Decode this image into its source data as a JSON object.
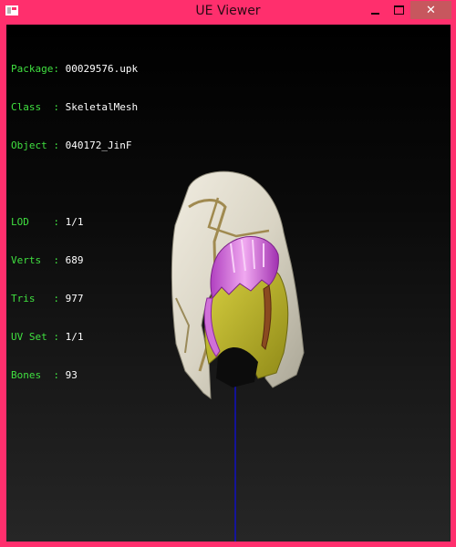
{
  "window": {
    "title": "UE Viewer",
    "close_glyph": "✕"
  },
  "info": {
    "group1": [
      {
        "label": "Package",
        "value": "00029576.upk"
      },
      {
        "label": "Class  ",
        "value": "SkeletalMesh"
      },
      {
        "label": "Object ",
        "value": "040172_JinF"
      }
    ],
    "group2": [
      {
        "label": "LOD    ",
        "value": "1/1"
      },
      {
        "label": "Verts  ",
        "value": "689"
      },
      {
        "label": "Tris   ",
        "value": "977"
      },
      {
        "label": "UV Set ",
        "value": "1/1"
      },
      {
        "label": "Bones  ",
        "value": "93"
      }
    ]
  },
  "colors": {
    "frame": "#ff2f6d",
    "label_green": "#40e040",
    "hood": "#ddd8c8",
    "hair": "#d070d8",
    "face": "#c8c030",
    "axis": "#1010c0"
  },
  "icons": [
    "app-icon",
    "minimize-icon",
    "maximize-icon",
    "close-icon"
  ]
}
